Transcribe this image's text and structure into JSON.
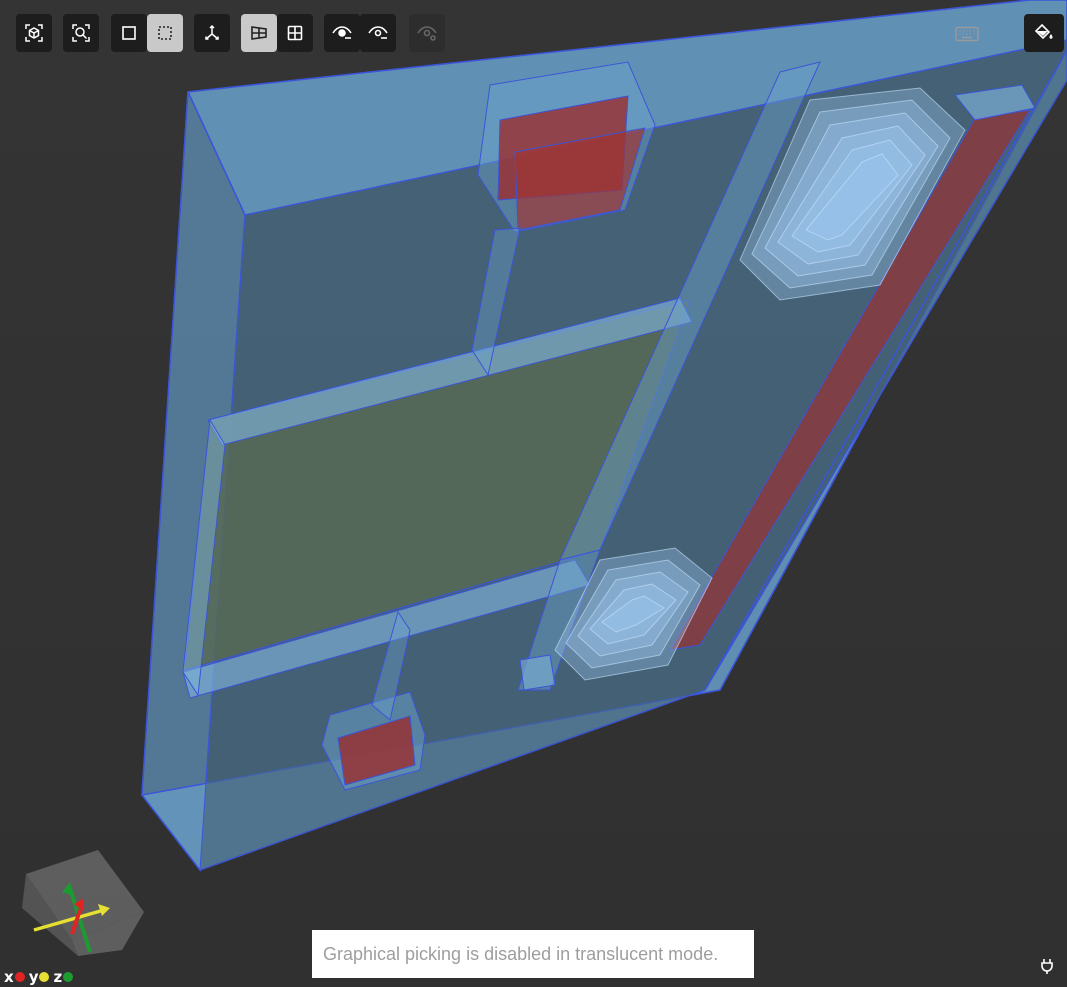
{
  "toolbar": {
    "buttons": [
      {
        "name": "fit-view-button",
        "icon": "cube-focus-icon",
        "active": false
      },
      {
        "name": "zoom-to-fit-button",
        "icon": "magnify-frame-icon",
        "active": false
      },
      {
        "name": "select-box-button",
        "icon": "square-icon",
        "active": false
      },
      {
        "name": "select-dashed-button",
        "icon": "dashed-square-icon",
        "active": true
      },
      {
        "name": "axes-button",
        "icon": "axes-icon",
        "active": false
      },
      {
        "name": "section-view-button",
        "icon": "section-plane-icon",
        "active": true
      },
      {
        "name": "grid-view-button",
        "icon": "grid-icon",
        "active": false
      },
      {
        "name": "hide-selected-button",
        "icon": "eye-minus-icon",
        "active": false
      },
      {
        "name": "hide-others-button",
        "icon": "eye-minus-alt-icon",
        "active": false
      },
      {
        "name": "show-all-button",
        "icon": "eye-settings-icon",
        "active": false,
        "disabled": true
      }
    ],
    "keyboard_icon": "keyboard-icon",
    "paint_icon": "paint-bucket-icon"
  },
  "notice": {
    "text": "Graphical picking is disabled in translucent mode."
  },
  "axis_legend": {
    "x": {
      "label": "x",
      "color": "#e02424"
    },
    "y": {
      "label": "y",
      "color": "#e6e032"
    },
    "z": {
      "label": "z",
      "color": "#1e9a32"
    }
  },
  "colors": {
    "background": "#323232",
    "translucent_blue": "#6fa8dc",
    "edge_blue": "#2a3fd6",
    "red_part": "#a52a2a",
    "green_panel": "#5a6b4a"
  },
  "status_icon": "plug-icon"
}
